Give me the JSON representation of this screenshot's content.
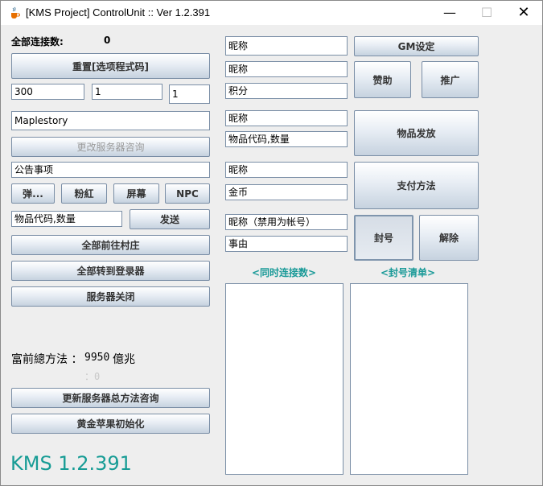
{
  "window": {
    "title": "[KMS Project] ControlUnit :: Ver 1.2.391",
    "minimize_glyph": "—",
    "maximize_glyph": "☐",
    "close_glyph": "✕"
  },
  "left": {
    "total_connections_label": "全部连接数:",
    "total_connections_value": "0",
    "reset_button": "重置[选项程式码]",
    "field_a": "300",
    "field_b": "1",
    "field_c": "1",
    "server_name": "Maplestory",
    "change_server_button": "更改服务器咨询",
    "notice_field": "公告事项",
    "popup_button": "弹...",
    "pink_button": "粉紅",
    "screen_button": "屏幕",
    "npc_button": "NPC",
    "item_code_field": "物品代码,数量",
    "send_button": "发送",
    "all_to_village_button": "全部前往村庄",
    "all_to_login_button": "全部转到登录器",
    "server_close_button": "服务器关闭",
    "total_method_label": "富前總方法 ：",
    "total_method_value": "9950",
    "total_method_unit": "億兆",
    "sub_value": "：0",
    "update_method_button": "更新服务器总方法咨询",
    "golden_apple_button": "黄金苹果初始化",
    "version_label": "KMS 1.2.391"
  },
  "middle": {
    "nickname_1": "昵称",
    "nickname_2": "昵称",
    "points": "积分",
    "nickname_3": "昵称",
    "item_code": "物品代码,数量",
    "nickname_4": "昵称",
    "gold": "金币",
    "ban_nickname": "昵称（禁用为帐号）",
    "reason": "事由",
    "concurrent_label": "<同时连接数>",
    "ban_list_label": "<封号清单>"
  },
  "right": {
    "gm_button": "GM设定",
    "sponsor_button": "赞助",
    "promote_button": "推广",
    "item_distribute_button": "物品发放",
    "payment_button": "支付方法",
    "ban_button": "封号",
    "unban_button": "解除"
  }
}
